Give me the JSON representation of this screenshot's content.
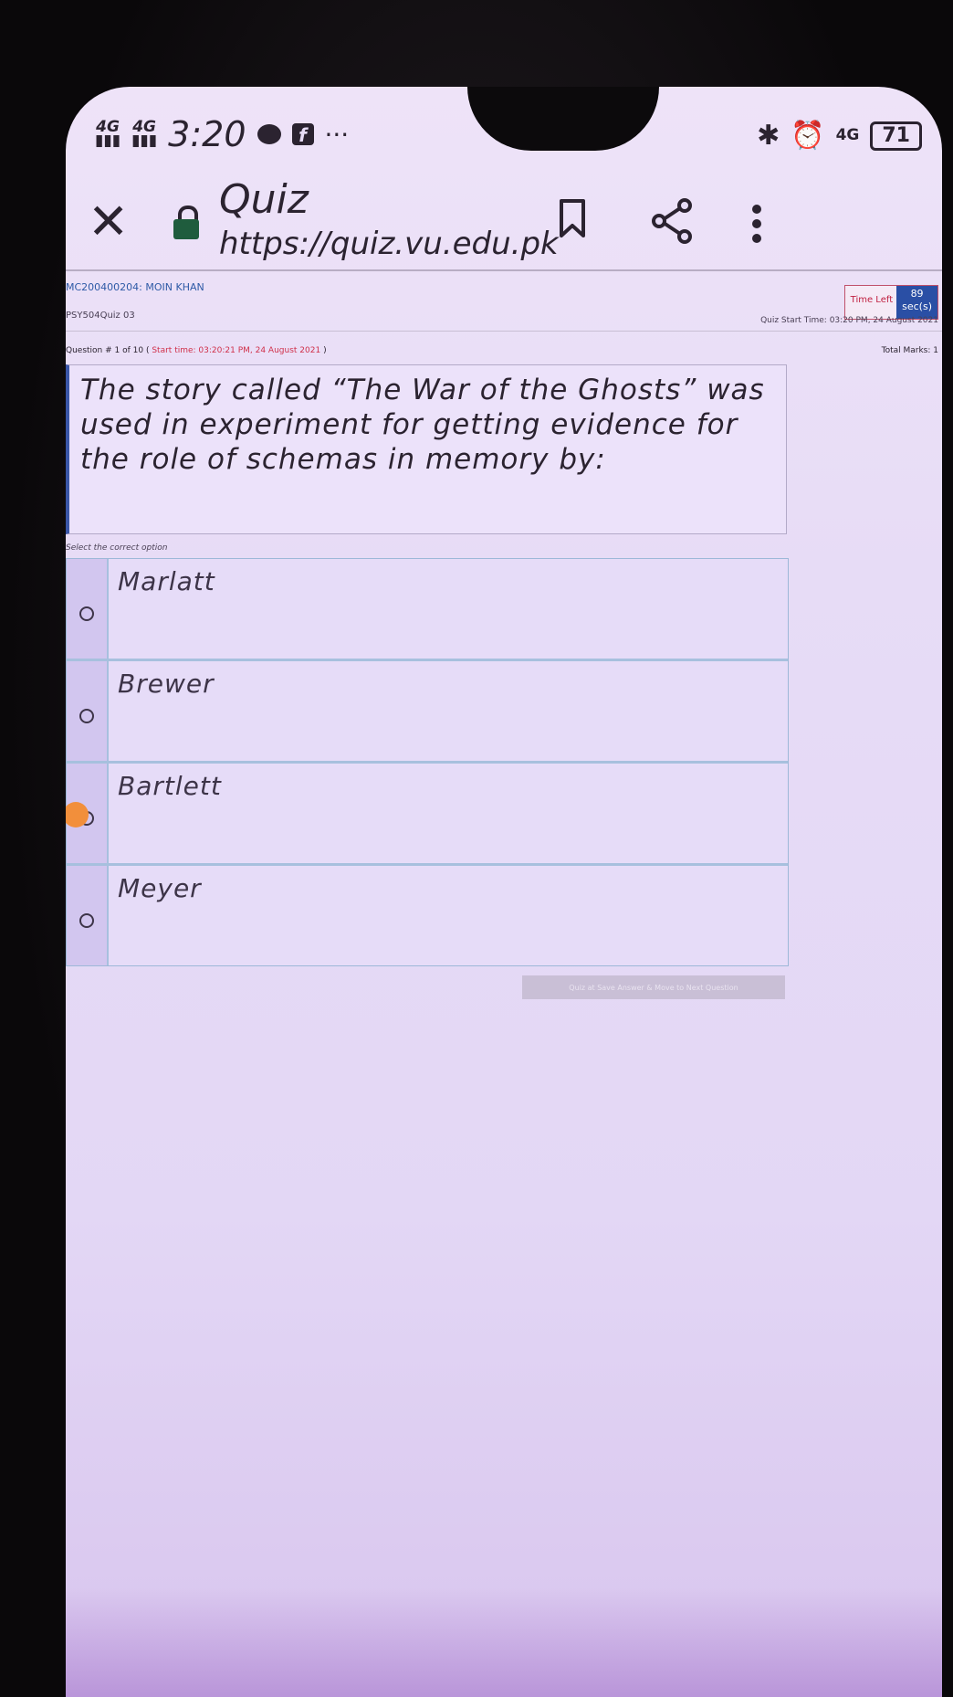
{
  "status_bar": {
    "signal1": "4G",
    "signal2": "4G",
    "time": "3:20",
    "more": "···",
    "right_network": "4G",
    "battery": "71"
  },
  "browser": {
    "page_title": "Quiz",
    "url": "https://quiz.vu.edu.pk"
  },
  "quiz": {
    "student": "MC200400204: MOIN KHAN",
    "course": "PSY504Quiz 03",
    "time_left_label": "Time Left",
    "time_left_value": "89",
    "time_left_unit": "sec(s)",
    "quiz_start_time": "Quiz Start Time: 03:20 PM, 24 August 2021",
    "question_number": "Question # 1 of 10 (",
    "question_start_time": "Start time: 03:20:21 PM, 24 August 2021",
    "question_number_close": ")",
    "total_marks": "Total Marks: 1",
    "question_text": "The story called “The War of the Ghosts” was used in experiment for getting evidence for the role of schemas in memory by:",
    "select_label": "Select the correct option",
    "options": [
      {
        "label": "Marlatt"
      },
      {
        "label": "Brewer"
      },
      {
        "label": "Bartlett"
      },
      {
        "label": "Meyer"
      }
    ],
    "selected_option": "Bartlett",
    "save_button": "Quiz at Save Answer & Move to Next Question"
  },
  "colors": {
    "accent_blue": "#2a4fa5",
    "timer_red": "#c02040",
    "touch_indicator": "#f28f3b"
  }
}
